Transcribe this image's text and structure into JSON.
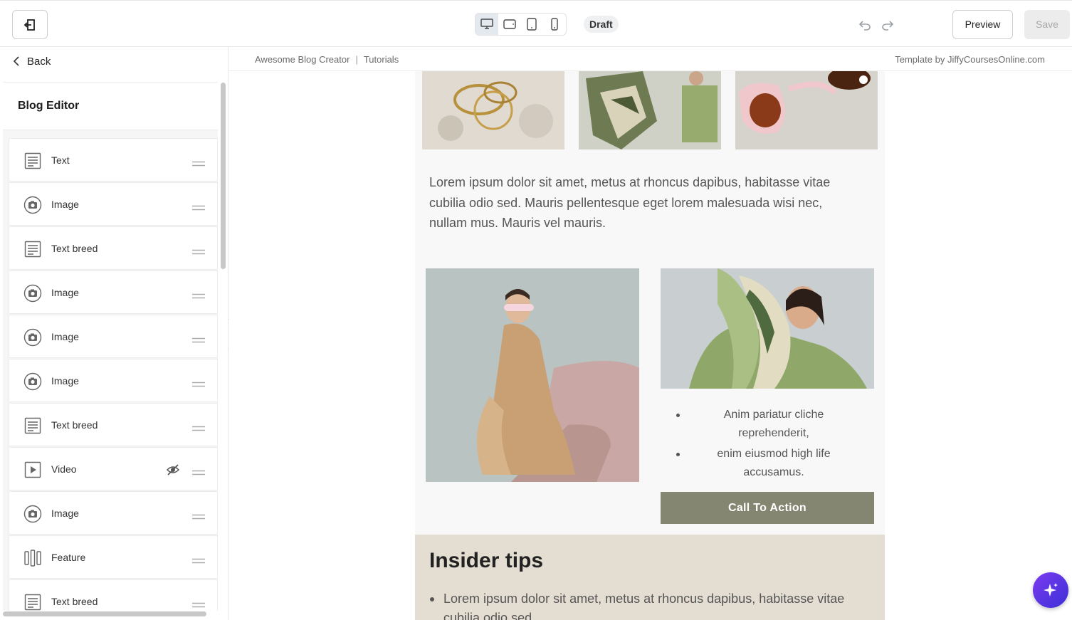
{
  "toolbar": {
    "status_badge": "Draft",
    "preview_label": "Preview",
    "save_label": "Save",
    "devices": [
      "desktop",
      "tablet-landscape",
      "tablet-portrait",
      "mobile"
    ],
    "active_device": "desktop"
  },
  "sidebar": {
    "back_label": "Back",
    "title": "Blog Editor",
    "blocks": [
      {
        "label": "Text",
        "icon": "text-block-icon"
      },
      {
        "label": "Image",
        "icon": "camera-icon"
      },
      {
        "label": "Text breed",
        "icon": "text-block-icon"
      },
      {
        "label": "Image",
        "icon": "camera-icon"
      },
      {
        "label": "Image",
        "icon": "camera-icon"
      },
      {
        "label": "Image",
        "icon": "camera-icon"
      },
      {
        "label": "Text breed",
        "icon": "text-block-icon"
      },
      {
        "label": "Video",
        "icon": "video-icon",
        "hidden": true
      },
      {
        "label": "Image",
        "icon": "camera-icon"
      },
      {
        "label": "Feature",
        "icon": "columns-icon"
      },
      {
        "label": "Text breed",
        "icon": "text-block-icon"
      }
    ]
  },
  "canvas": {
    "breadcrumb": [
      "Awesome Blog Creator",
      "Tutorials"
    ],
    "breadcrumb_separator": "|",
    "template_credit": "Template by JiffyCoursesOnline.com",
    "paragraph": "Lorem ipsum dolor sit amet, metus at rhoncus dapibus, habitasse vitae cubilia odio sed. Mauris pellentesque eget lorem malesuada wisi nec, nullam mus. Mauris vel mauris.",
    "bullets": [
      "Anim pariatur cliche reprehenderit,",
      "enim eiusmod high life accusamus."
    ],
    "cta_label": "Call To Action",
    "tips_title": "Insider tips",
    "tips_items": [
      "Lorem ipsum dolor sit amet, metus at rhoncus dapibus, habitasse vitae cubilia odio sed."
    ]
  },
  "colors": {
    "cta": "#858672",
    "tips_bg": "#e4ddd2",
    "ai_button": "#5b35e6"
  }
}
